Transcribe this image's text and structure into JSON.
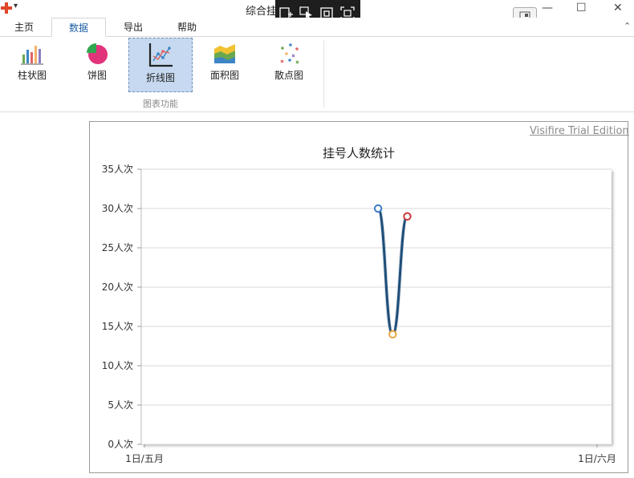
{
  "window": {
    "title": "综合挂",
    "controls": {
      "minimize": "—",
      "maximize": "☐",
      "close": "✕"
    }
  },
  "tabs": [
    {
      "label": "主页",
      "active": false
    },
    {
      "label": "数据",
      "active": true
    },
    {
      "label": "导出",
      "active": false
    },
    {
      "label": "帮助",
      "active": false
    }
  ],
  "ribbon": {
    "group_label": "图表功能",
    "buttons": [
      {
        "label": "柱状图",
        "icon": "bar-chart-icon",
        "selected": false
      },
      {
        "label": "饼图",
        "icon": "pie-chart-icon",
        "selected": false
      },
      {
        "label": "折线图",
        "icon": "line-chart-icon",
        "selected": true
      },
      {
        "label": "面积图",
        "icon": "area-chart-icon",
        "selected": false
      },
      {
        "label": "散点图",
        "icon": "scatter-chart-icon",
        "selected": false
      }
    ],
    "collapse_glyph": "⌃"
  },
  "watermark": "Visifire Trial Edition",
  "chart_data": {
    "type": "line",
    "title": "挂号人数统计",
    "xlabel": "",
    "ylabel": "",
    "y_unit": "人次",
    "ylim": [
      0,
      35
    ],
    "y_ticks": [
      "0人次",
      "5人次",
      "10人次",
      "15人次",
      "20人次",
      "25人次",
      "30人次",
      "35人次"
    ],
    "x_ticks": [
      "1日/五月",
      "1日/六月"
    ],
    "grid": true,
    "legend": "none",
    "series": [
      {
        "points": [
          {
            "x": "2014-05-17",
            "y": 30,
            "marker_color": "#3a7cc4"
          },
          {
            "x": "2014-05-18",
            "y": 14,
            "marker_color": "#e8a33c"
          },
          {
            "x": "2014-05-19",
            "y": 29,
            "marker_color": "#c8383a"
          }
        ],
        "line_color": "#1f4e79"
      }
    ]
  }
}
